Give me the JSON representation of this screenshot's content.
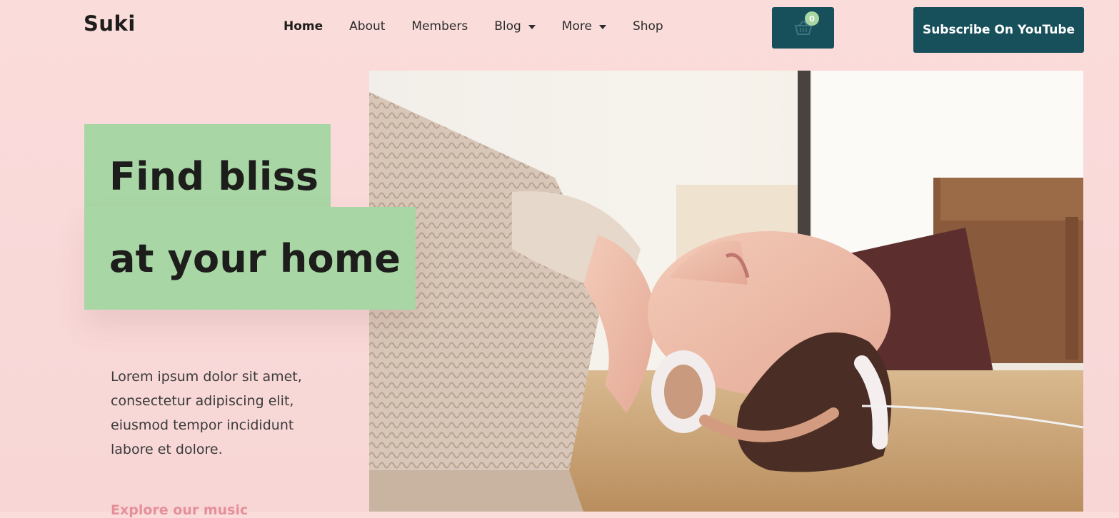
{
  "brand": {
    "logo_text": "Suki"
  },
  "nav": {
    "items": [
      {
        "label": "Home",
        "active": true,
        "has_dropdown": false
      },
      {
        "label": "About",
        "active": false,
        "has_dropdown": false
      },
      {
        "label": "Members",
        "active": false,
        "has_dropdown": false
      },
      {
        "label": "Blog",
        "active": false,
        "has_dropdown": true
      },
      {
        "label": "More",
        "active": false,
        "has_dropdown": true
      },
      {
        "label": "Shop",
        "active": false,
        "has_dropdown": false
      }
    ]
  },
  "cart": {
    "icon": "basket-icon",
    "count": "0"
  },
  "header": {
    "subscribe_label": "Subscribe On YouTube"
  },
  "hero": {
    "headline_line1": "Find bliss",
    "headline_line2": "at your home",
    "description": "Lorem ipsum dolor sit amet, consectetur adipiscing elit, eiusmod tempor incididunt labore et dolore.",
    "cta_label": "Explore our music"
  },
  "colors": {
    "background": "#fadcdb",
    "accent_dark_teal": "#17505b",
    "accent_green": "#a9d6a5",
    "link_pink": "#e58f98"
  }
}
